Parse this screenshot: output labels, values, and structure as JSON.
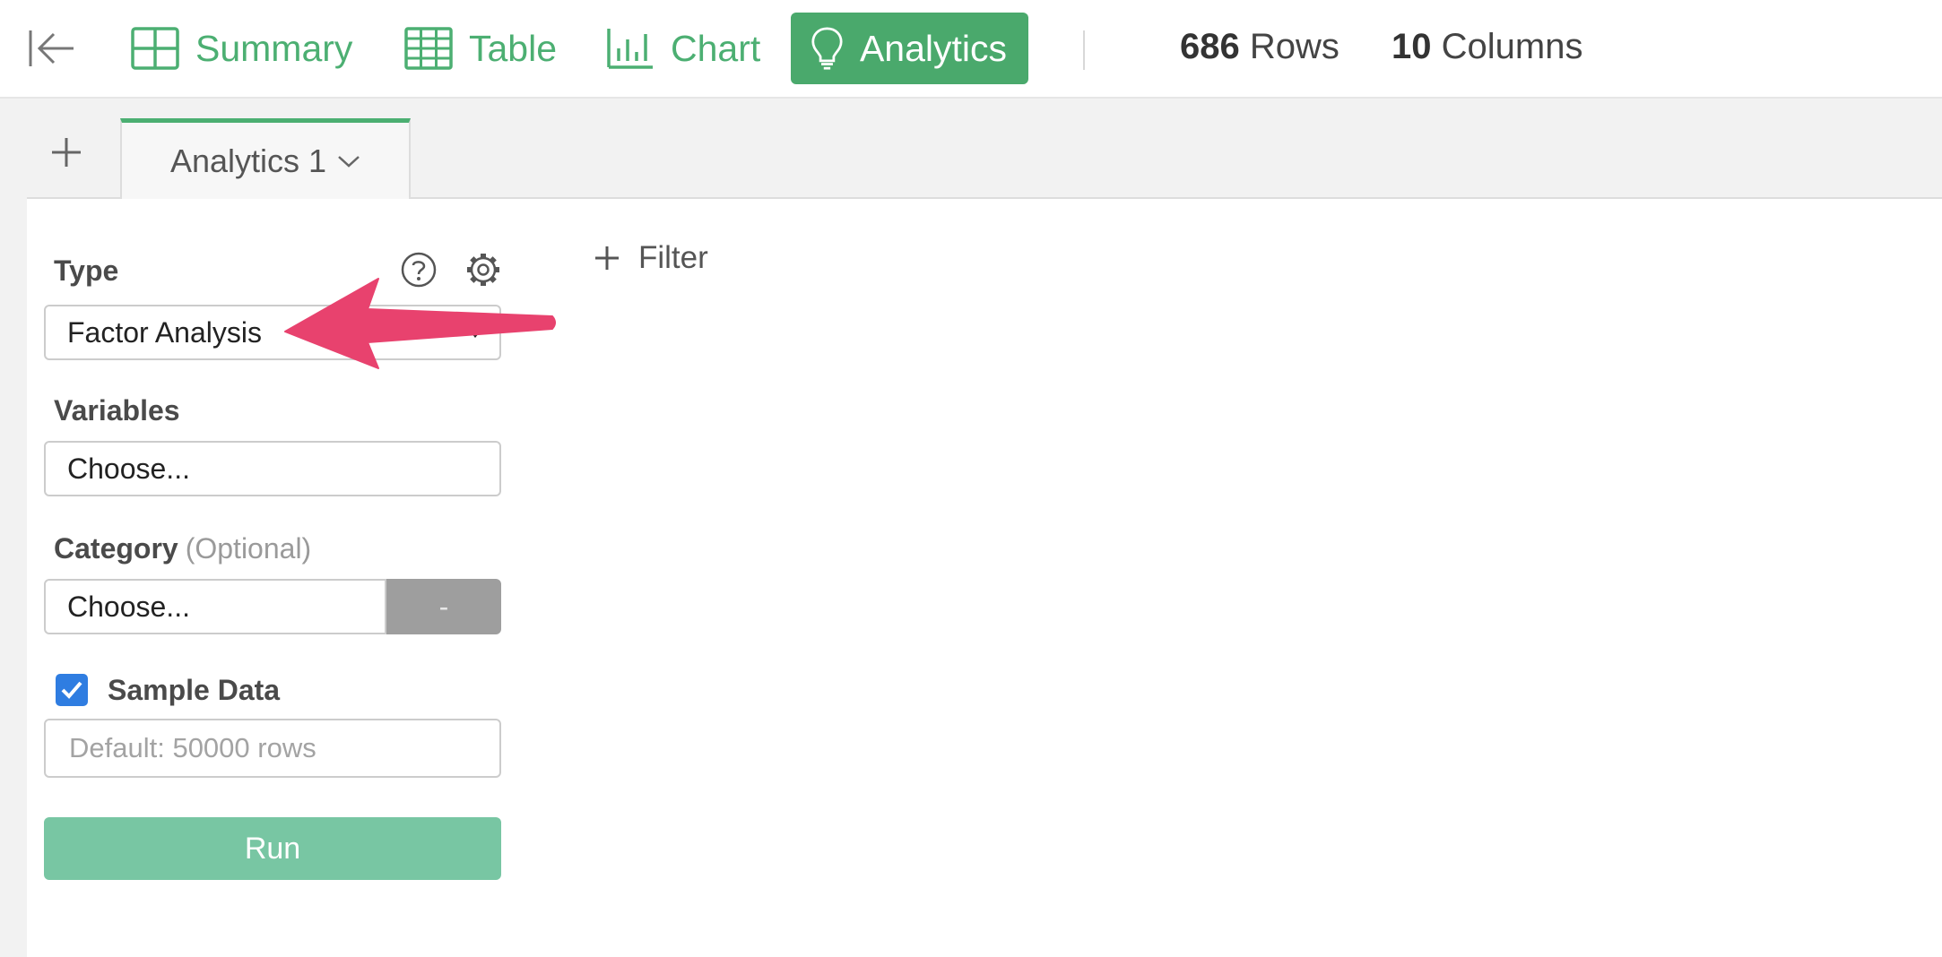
{
  "header": {
    "nav": [
      {
        "label": "Summary",
        "icon": "grid-icon"
      },
      {
        "label": "Table",
        "icon": "table-icon"
      },
      {
        "label": "Chart",
        "icon": "bar-chart-icon"
      },
      {
        "label": "Analytics",
        "icon": "lightbulb-icon",
        "active": true
      }
    ],
    "rows_count": "686",
    "rows_label": "Rows",
    "columns_count": "10",
    "columns_label": "Columns"
  },
  "tabs": {
    "add_icon": "plus-icon",
    "items": [
      {
        "label": "Analytics 1",
        "active": true
      }
    ]
  },
  "form": {
    "type_label": "Type",
    "type_value": "Factor Analysis",
    "variables_label": "Variables",
    "variables_value": "Choose...",
    "category_label": "Category",
    "category_optional": "(Optional)",
    "category_value": "Choose...",
    "category_clear": "-",
    "sample_label": "Sample Data",
    "sample_checked": true,
    "sample_placeholder": "Default: 50000 rows",
    "run_label": "Run"
  },
  "filter": {
    "label": "Filter"
  },
  "colors": {
    "accent": "#4aa96c",
    "run_button": "#78c6a3",
    "checkbox": "#2f7de1",
    "annotation_arrow": "#e8426e"
  }
}
